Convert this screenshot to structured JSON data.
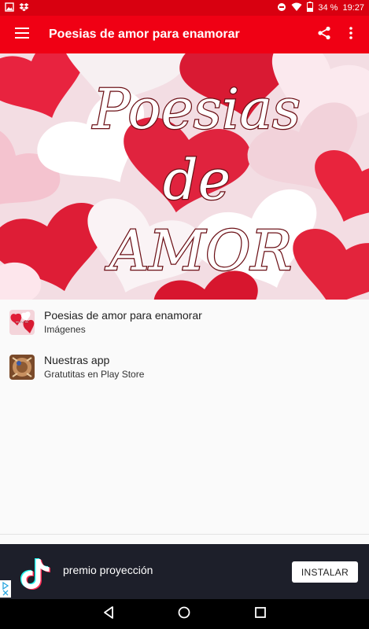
{
  "status_bar": {
    "battery_percent": "34 %",
    "time": "19:27",
    "icons": [
      "image-icon",
      "dropbox-icon",
      "dnd-icon",
      "wifi-icon",
      "battery-icon"
    ]
  },
  "toolbar": {
    "title": "Poesias de amor para enamorar",
    "icons": [
      "menu-icon",
      "share-icon",
      "more-icon"
    ]
  },
  "banner": {
    "lines": [
      "Poesias",
      "de",
      "AMOR"
    ]
  },
  "list": {
    "items": [
      {
        "title": "Poesias de amor para enamorar",
        "subtitle": "Imágenes",
        "icon": "poesias-thumb"
      },
      {
        "title": "Nuestras app",
        "subtitle": "Gratutitas en Play Store",
        "icon": "app-thumb"
      }
    ]
  },
  "ad": {
    "text": "premio proyección",
    "button": "INSTALAR",
    "logo": "tiktok-logo"
  },
  "navbar": {
    "icons": [
      "back-icon",
      "home-icon",
      "recents-icon"
    ]
  },
  "colors": {
    "status_bar": "#d80010",
    "toolbar": "#f00014",
    "background": "#fafafa",
    "ad_background": "#1d1f2a"
  }
}
